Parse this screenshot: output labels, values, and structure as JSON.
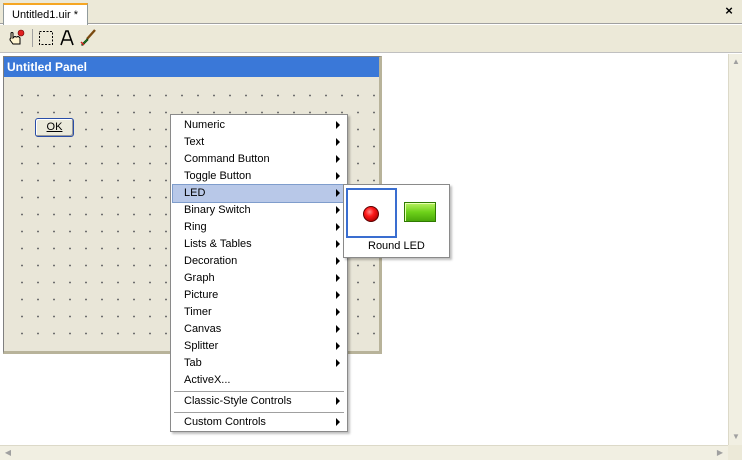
{
  "document_tab": {
    "label": "Untitled1.uir *"
  },
  "window": {
    "close_glyph": "×"
  },
  "toolbar": {
    "tools": [
      {
        "name": "operate-tool",
        "icon": "pointing-hand-icon"
      },
      {
        "name": "select-tool",
        "icon": "selection-rectangle-icon"
      },
      {
        "name": "label-tool",
        "icon": "text-a-icon"
      },
      {
        "name": "color-tool",
        "icon": "paint-brush-icon"
      }
    ]
  },
  "panel": {
    "title": "Untitled Panel",
    "ok_button": {
      "label": "OK",
      "mnemonic": "O"
    }
  },
  "context_menu": {
    "items": [
      {
        "label": "Numeric",
        "submenu": true
      },
      {
        "label": "Text",
        "submenu": true
      },
      {
        "label": "Command Button",
        "submenu": true
      },
      {
        "label": "Toggle Button",
        "submenu": true
      },
      {
        "label": "LED",
        "submenu": true,
        "selected": true
      },
      {
        "label": "Binary Switch",
        "submenu": true
      },
      {
        "label": "Ring",
        "submenu": true
      },
      {
        "label": "Lists & Tables",
        "submenu": true
      },
      {
        "label": "Decoration",
        "submenu": true
      },
      {
        "label": "Graph",
        "submenu": true
      },
      {
        "label": "Picture",
        "submenu": true
      },
      {
        "label": "Timer",
        "submenu": true
      },
      {
        "label": "Canvas",
        "submenu": true
      },
      {
        "label": "Splitter",
        "submenu": true
      },
      {
        "label": "Tab",
        "submenu": true
      },
      {
        "label": "ActiveX...",
        "submenu": false
      }
    ],
    "classic_items": [
      {
        "label": "Classic-Style Controls",
        "submenu": true
      }
    ],
    "custom_items": [
      {
        "label": "Custom Controls",
        "submenu": true
      }
    ]
  },
  "led_submenu": {
    "caption": "Round LED",
    "round_led_color": "#ff1a1a",
    "square_led_color": "#6ed21a"
  },
  "colors": {
    "panel_title_bg": "#3a78d8",
    "tab_accent": "#f5a623",
    "menu_highlight": "#b8c8e8"
  }
}
